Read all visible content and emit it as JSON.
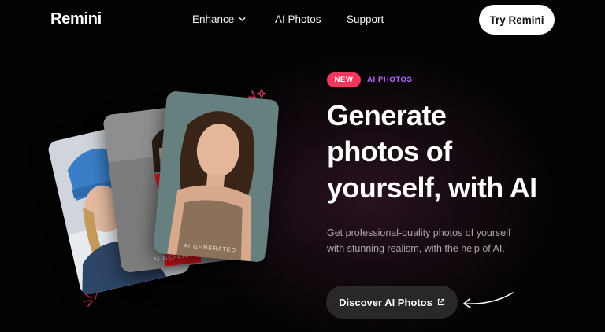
{
  "nav": {
    "logo": "Remini",
    "links": [
      {
        "label": "Enhance"
      },
      {
        "label": "AI Photos"
      },
      {
        "label": "Support"
      }
    ],
    "cta": "Try Remini"
  },
  "hero": {
    "badge_new": "NEW",
    "badge_category": "AI PHOTOS",
    "headline_lines": [
      "Generate",
      "photos of",
      "yourself, with AI"
    ],
    "subtext_lines": [
      "Get professional-quality photos of yourself",
      "with stunning realism, with the help of AI."
    ],
    "button_label": "Discover AI Photos",
    "card_label": "AI GENERATED"
  },
  "colors": {
    "badge_new_bg": "#f2375f",
    "badge_category_text": "#b66bff",
    "button_bg": "#2a272b",
    "sparkle_color": "#f2375f"
  },
  "icons": {
    "dropdown": "chevron-down-icon",
    "external": "external-link-icon",
    "arrow": "curved-arrow-icon",
    "sparkle": "sparkle-icon"
  }
}
